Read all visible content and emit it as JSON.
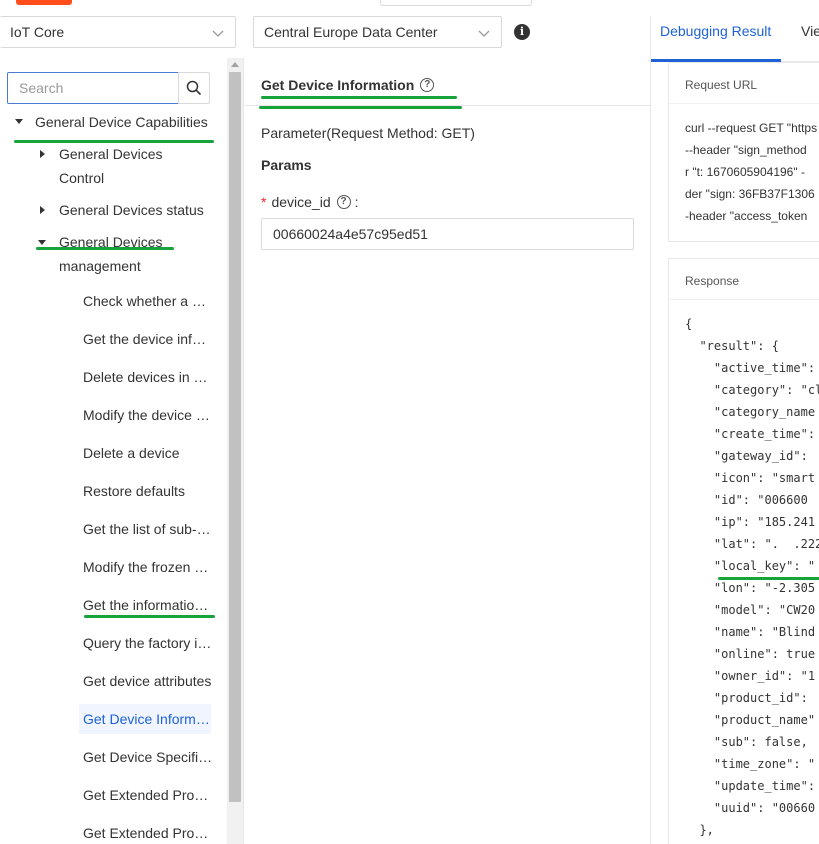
{
  "header": {
    "product_select": "IoT Core",
    "datacenter_select": "Central Europe Data Center"
  },
  "sidebar": {
    "search_placeholder": "Search",
    "root_label": "General Device Capabilities",
    "groups": [
      {
        "label_line1": "General Devices",
        "label_line2": "Control"
      },
      {
        "label_line1": "General Devices status",
        "label_line2": ""
      },
      {
        "label_line1": "General Devices",
        "label_line2": "management"
      }
    ],
    "items": [
      "Check whether a device is online",
      "Get the device information",
      "Delete devices in batches",
      "Modify the device name",
      "Delete a device",
      "Restore defaults",
      "Get the list of sub-devices",
      "Modify the frozen state",
      "Get the information of a device",
      "Query the factory information",
      "Get device attributes",
      "Get Device Information",
      "Get Device Specification",
      "Get Extended Properties",
      "Get Extended Properties"
    ]
  },
  "main": {
    "title": "Get Device Information",
    "param_heading": "Parameter(Request Method: GET)",
    "params_label": "Params",
    "field_label": "device_id",
    "field_value": "00660024a4e57c95ed51"
  },
  "right": {
    "tabs": [
      "Debugging Result",
      "View"
    ],
    "request_title": "Request URL",
    "curl_lines": [
      "curl --request GET \"https",
      "--header \"sign_method",
      "r \"t: 1670605904196\" -",
      "der \"sign: 36FB37F1306",
      "-header \"access_token"
    ],
    "response_title": "Response",
    "json_lines": [
      "{",
      "  \"result\": {",
      "    \"active_time\":",
      "    \"category\": \"cl",
      "    \"category_name",
      "    \"create_time\":",
      "    \"gateway_id\":",
      "    \"icon\": \"smart",
      "    \"id\": \"006600",
      "    \"ip\": \"185.241",
      "    \"lat\": \".  .222",
      "    \"local_key\": \"",
      "    \"lon\": \"-2.305",
      "    \"model\": \"CW20",
      "    \"name\": \"Blind",
      "    \"online\": true",
      "    \"owner_id\": \"1",
      "    \"product_id\":",
      "    \"product_name\"",
      "    \"sub\": false,",
      "    \"time_zone\": \"",
      "    \"update_time\":",
      "    \"uuid\": \"00660",
      "  },"
    ]
  }
}
